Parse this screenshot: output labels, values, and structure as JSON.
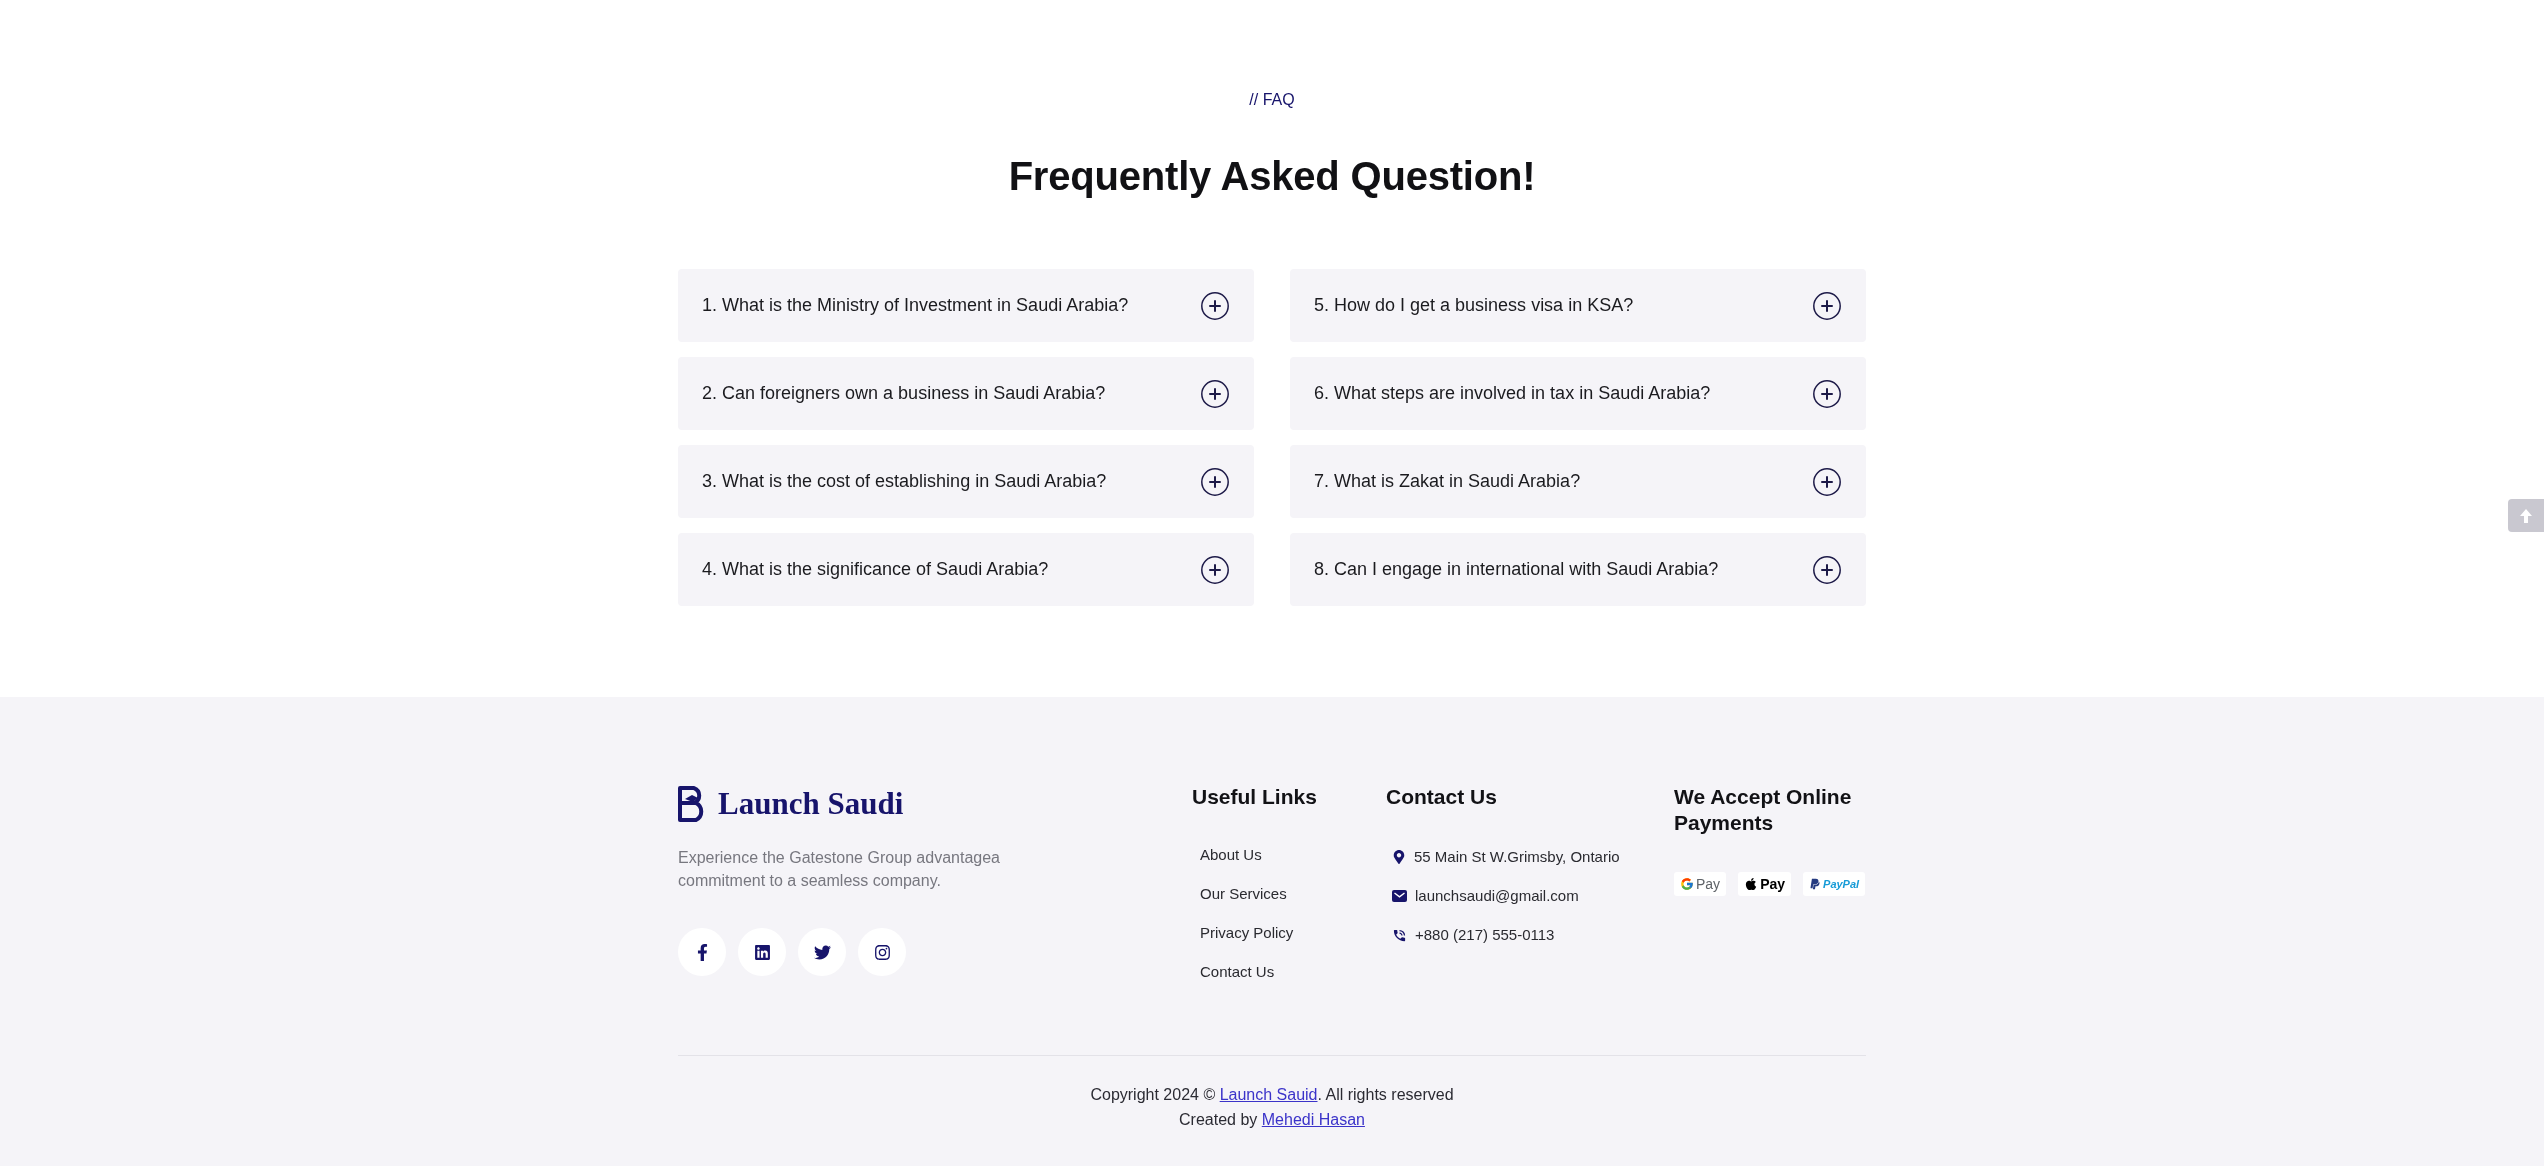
{
  "faq": {
    "label": "// FAQ",
    "title": "Frequently Asked Question!",
    "items": [
      {
        "question": "1. What is the Ministry of Investment in Saudi Arabia?",
        "expanded": false
      },
      {
        "question": "2. Can foreigners own a business in Saudi Arabia?",
        "expanded": false
      },
      {
        "question": "3. What is the cost of establishing in Saudi Arabia?",
        "expanded": false
      },
      {
        "question": "4. What is the significance of Saudi Arabia?",
        "expanded": false
      },
      {
        "question": "5. How do I get a business visa in KSA?",
        "expanded": false
      },
      {
        "question": "6. What steps are involved in tax in Saudi Arabia?",
        "expanded": false
      },
      {
        "question": "7. What is Zakat in Saudi Arabia?",
        "expanded": false
      },
      {
        "question": "8. Can I engage in international with Saudi Arabia?",
        "expanded": false
      }
    ]
  },
  "footer": {
    "brand": {
      "name": "Launch Saudi",
      "description": "Experience the Gatestone Group advantagea commitment to a seamless company."
    },
    "useful_links": {
      "heading": "Useful Links",
      "items": [
        "About Us",
        "Our Services",
        "Privacy Policy",
        "Contact Us"
      ]
    },
    "contact": {
      "heading": "Contact Us",
      "items": [
        {
          "kind": "address",
          "text": "55 Main St W.Grimsby, Ontario"
        },
        {
          "kind": "email",
          "text": "launchsaudi@gmail.com"
        },
        {
          "kind": "phone",
          "text": "+880 (217) 555-0113"
        }
      ]
    },
    "payments": {
      "heading": "We Accept Online Payments",
      "methods": [
        {
          "kind": "google_pay",
          "label": "Pay"
        },
        {
          "kind": "apple_pay",
          "label": "Pay"
        },
        {
          "kind": "paypal",
          "label": "PayPal"
        }
      ]
    },
    "copyright": {
      "text_before": "Copyright 2024 ©",
      "link": "Launch Sauid",
      "text_after": ". All rights reserved"
    },
    "credit": {
      "text": "Created by",
      "link": "Mehedi Hasan"
    }
  }
}
